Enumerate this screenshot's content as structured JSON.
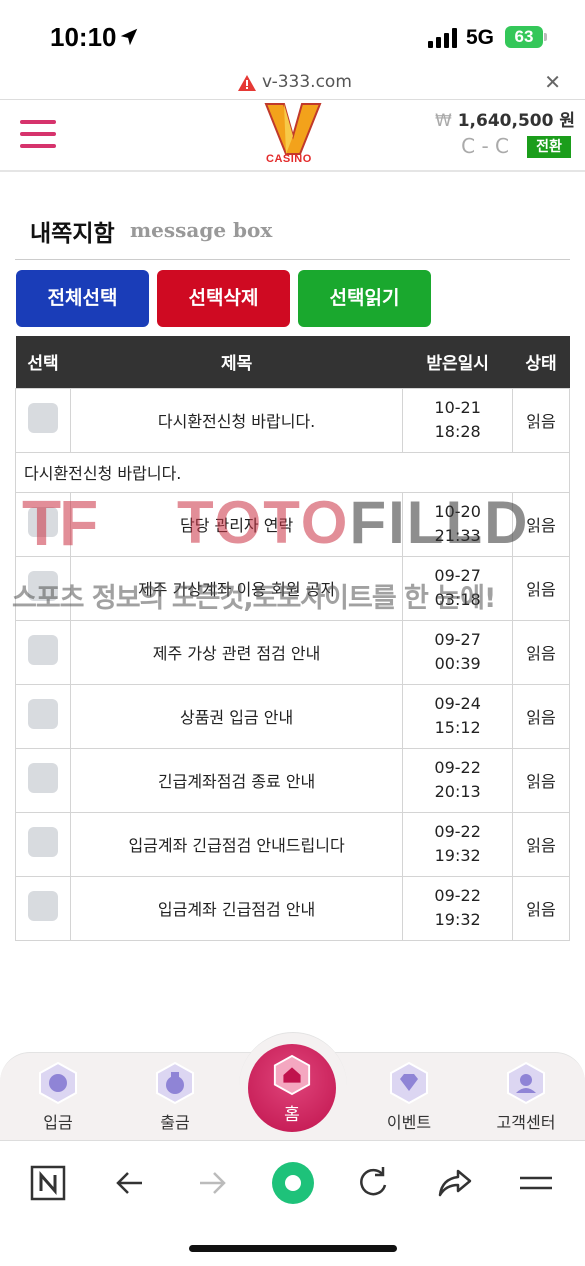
{
  "status_bar": {
    "time": "10:10",
    "network": "5G",
    "battery": "63"
  },
  "url_bar": {
    "url": "v-333.com"
  },
  "header": {
    "logo_text": "CASINO",
    "balance_currency": "₩",
    "balance": "1,640,500 원",
    "refresh_text": "C - C",
    "switch_label": "전환",
    "accent_color": "#d6336c"
  },
  "page": {
    "title": "내쪽지함",
    "subtitle": "message box"
  },
  "actions": {
    "select_all": "전체선택",
    "delete_selected": "선택삭제",
    "read_selected": "선택읽기"
  },
  "table": {
    "headers": {
      "select": "선택",
      "subject": "제목",
      "received": "받은일시",
      "status": "상태"
    },
    "expanded_message": "다시환전신청 바랍니다.",
    "rows": [
      {
        "subject": "다시환전신청 바랍니다.",
        "date": "10-21",
        "time": "18:28",
        "status": "읽음"
      },
      {
        "subject": "담당 관리자 연락",
        "date": "10-20",
        "time": "21:33",
        "status": "읽음"
      },
      {
        "subject": "제주 가상계좌 이용 회원 공지",
        "date": "09-27",
        "time": "03:18",
        "status": "읽음"
      },
      {
        "subject": "제주 가상 관련 점검 안내",
        "date": "09-27",
        "time": "00:39",
        "status": "읽음"
      },
      {
        "subject": "상품권 입금 안내",
        "date": "09-24",
        "time": "15:12",
        "status": "읽음"
      },
      {
        "subject": "긴급계좌점검 종료 안내",
        "date": "09-22",
        "time": "20:13",
        "status": "읽음"
      },
      {
        "subject": "입금계좌 긴급점검 안내드립니다",
        "date": "09-22",
        "time": "19:32",
        "status": "읽음"
      },
      {
        "subject": "입금계좌 긴급점검 안내",
        "date": "09-22",
        "time": "19:32",
        "status": "읽음"
      }
    ]
  },
  "watermark": {
    "logo": "TF",
    "title_red": "TOTO",
    "title_dark": "FILLD",
    "slogan": "스포츠 정보의 모든것,토토사이트를 한 눈에!"
  },
  "bottom_nav": {
    "deposit": "입금",
    "withdraw": "출금",
    "home": "홈",
    "event": "이벤트",
    "support": "고객센터"
  }
}
